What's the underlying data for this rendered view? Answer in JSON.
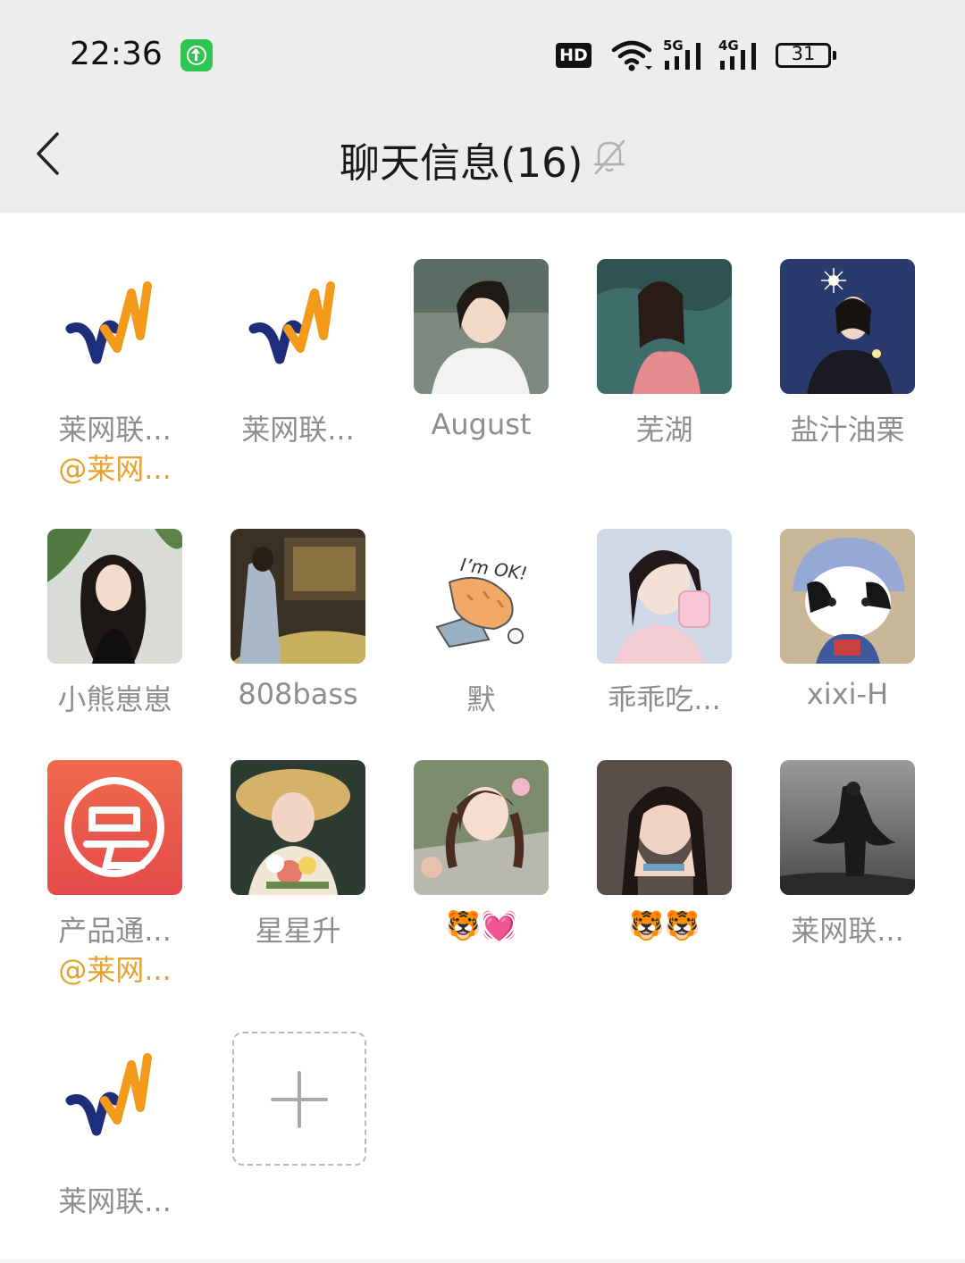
{
  "status_bar": {
    "time": "22:36",
    "hd_label": "HD",
    "network_5g": "5G",
    "network_4g": "4G",
    "battery_level": "31",
    "icons": [
      "upload-app-icon",
      "wifi-icon",
      "signal-icon",
      "battery-icon"
    ]
  },
  "header": {
    "title": "聊天信息(16)",
    "back_icon": "chevron-left-icon",
    "mute_icon": "bell-off-icon"
  },
  "members": [
    {
      "name": "莱网联...",
      "sub": "@莱网...",
      "avatar": "logo-vn"
    },
    {
      "name": "莱网联...",
      "sub": "",
      "avatar": "logo-vn"
    },
    {
      "name": "August",
      "sub": "",
      "avatar": "photo-girl-white"
    },
    {
      "name": "芜湖",
      "sub": "",
      "avatar": "photo-girl-water"
    },
    {
      "name": "盐汁油栗",
      "sub": "",
      "avatar": "photo-sparkler"
    },
    {
      "name": "小熊崽崽",
      "sub": "",
      "avatar": "photo-girl-plant"
    },
    {
      "name": "808bass",
      "sub": "",
      "avatar": "photo-room"
    },
    {
      "name": "默",
      "sub": "",
      "avatar": "sticker-cat-im-ok"
    },
    {
      "name": "乖乖吃...",
      "sub": "",
      "avatar": "photo-girl-icecream"
    },
    {
      "name": "xixi-H",
      "sub": "",
      "avatar": "photo-cat-hat"
    },
    {
      "name": "产品通...",
      "sub": "@莱网...",
      "avatar": "logo-red"
    },
    {
      "name": "星星升",
      "sub": "",
      "avatar": "photo-girl-hat-flowers"
    },
    {
      "name": "🐯💓",
      "sub": "",
      "avatar": "photo-girl-pigtails"
    },
    {
      "name": "🐯🐯",
      "sub": "",
      "avatar": "photo-girl-hands"
    },
    {
      "name": "莱网联...",
      "sub": "",
      "avatar": "photo-cloaked-figure"
    },
    {
      "name": "莱网联...",
      "sub": "",
      "avatar": "logo-vn"
    }
  ],
  "sticker_text": "I'm OK!",
  "colors": {
    "header_bg": "#ededed",
    "name_gray": "#8e8e8e",
    "mention_orange": "#e8a02e",
    "app_green": "#2fc552"
  }
}
